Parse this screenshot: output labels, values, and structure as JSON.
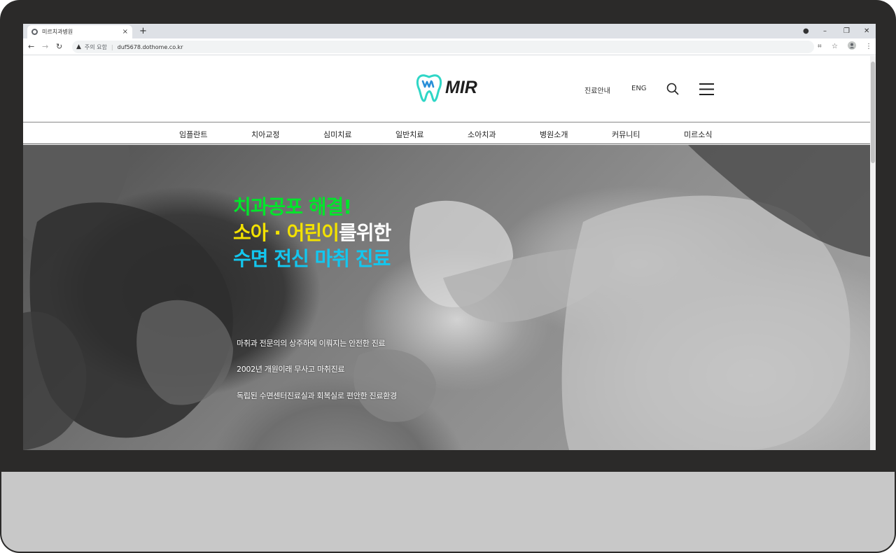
{
  "browser": {
    "tab_title": "미르치과병원",
    "tab_close": "×",
    "new_tab": "+",
    "window_controls": {
      "record": "●",
      "minimize": "–",
      "restore": "❐",
      "close": "✕"
    },
    "nav": {
      "back": "←",
      "forward": "→",
      "reload": "↻"
    },
    "security_icon": "▲",
    "security_label": "주의 요함",
    "separator": "|",
    "url": "duf5678.dothome.co.kr",
    "tool_icons": [
      "qr-code-icon",
      "star-icon",
      "profile-icon",
      "kebab-menu-icon"
    ]
  },
  "header": {
    "logo_text": "MIR",
    "links": {
      "guide": "진료안내",
      "eng": "ENG"
    },
    "icons": [
      "search-icon",
      "hamburger-menu-icon"
    ]
  },
  "gnb": {
    "items": [
      "임플란트",
      "치아교정",
      "심미치료",
      "일반치료",
      "소아치과",
      "병원소개",
      "커뮤니티",
      "미르소식"
    ]
  },
  "hero": {
    "line1": "치과공포 해결!",
    "line2_highlight": "소아 · 어린이",
    "line2_rest": "를위한",
    "line3": "수면 전신 마취 진료",
    "descriptions": [
      "마취과 전문의의 상주하에 이뤄지는 안전한 진료",
      "2002년 개원이래 무사고 마취진료",
      "독립된 수면센터진료실과 회복실로 편안한 진료환경"
    ]
  },
  "colors": {
    "hero_line1": "#00e52b",
    "hero_line2_highlight": "#f2e100",
    "hero_line3": "#13c7ef",
    "logo_tooth_outer": "#2fd6c6",
    "logo_tooth_inner": "#2a8fd8",
    "monitor_bezel": "#2b2a29",
    "monitor_chin": "#c8c8c8"
  }
}
